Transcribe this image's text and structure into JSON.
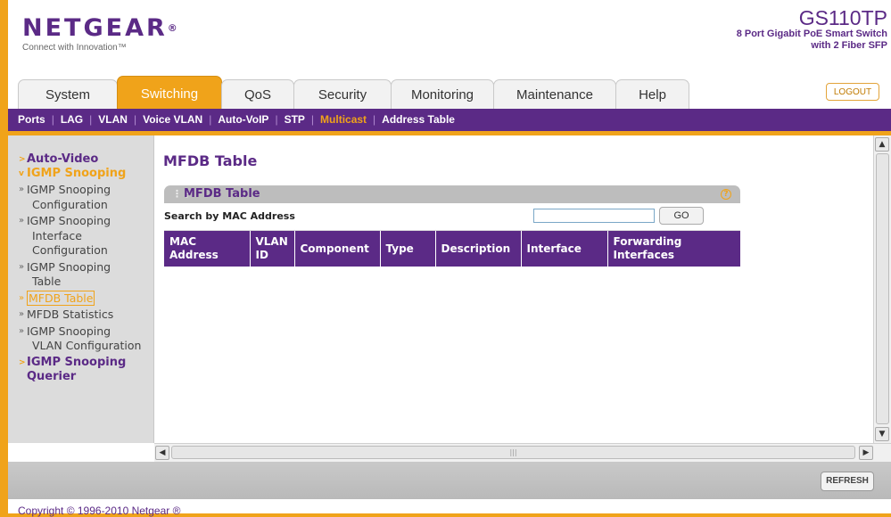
{
  "header": {
    "logo": "NETGEAR",
    "logo_mark": "®",
    "tagline": "Connect with Innovation™",
    "product_name": "GS110TP",
    "product_desc": "8 Port Gigabit PoE Smart Switch\nwith 2 Fiber SFP"
  },
  "tabs": [
    {
      "label": "System"
    },
    {
      "label": "Switching",
      "active": true
    },
    {
      "label": "QoS"
    },
    {
      "label": "Security"
    },
    {
      "label": "Monitoring"
    },
    {
      "label": "Maintenance"
    },
    {
      "label": "Help"
    }
  ],
  "logout_label": "LOGOUT",
  "subnav": [
    {
      "label": "Ports"
    },
    {
      "label": "LAG"
    },
    {
      "label": "VLAN"
    },
    {
      "label": "Voice VLAN"
    },
    {
      "label": "Auto-VoIP"
    },
    {
      "label": "STP"
    },
    {
      "label": "Multicast",
      "active": true
    },
    {
      "label": "Address Table"
    }
  ],
  "sidebar": {
    "auto_video": "Auto-Video",
    "igmp_snooping": "IGMP Snooping",
    "items": [
      {
        "line1": "IGMP Snooping",
        "rest": "Configuration"
      },
      {
        "line1": "IGMP Snooping",
        "rest": "Interface Configuration"
      },
      {
        "line1": "IGMP Snooping",
        "rest": "Table"
      },
      {
        "line1": "MFDB Table",
        "rest": "",
        "active": true
      },
      {
        "line1": "MFDB Statistics",
        "rest": ""
      },
      {
        "line1": "IGMP Snooping",
        "rest": "VLAN Configuration"
      }
    ],
    "querier": "IGMP Snooping Querier"
  },
  "main": {
    "page_title": "MFDB Table",
    "panel_title": "MFDB Table",
    "help_glyph": "?",
    "search_label": "Search by MAC Address",
    "search_value": "",
    "go_label": "GO",
    "columns": [
      "MAC Address",
      "VLAN ID",
      "Component",
      "Type",
      "Description",
      "Interface",
      "Forwarding Interfaces"
    ]
  },
  "refresh_label": "REFRESH",
  "copyright": "Copyright © 1996-2010 Netgear ®",
  "colors": {
    "accent": "#f0a31a",
    "brand": "#5b2a86",
    "header_bg": "#bdbdbd"
  },
  "icons": {
    "scroll_up": "▲",
    "scroll_down": "▼",
    "scroll_left": "◀",
    "scroll_right": "▶",
    "grip": "⋮⋮"
  }
}
